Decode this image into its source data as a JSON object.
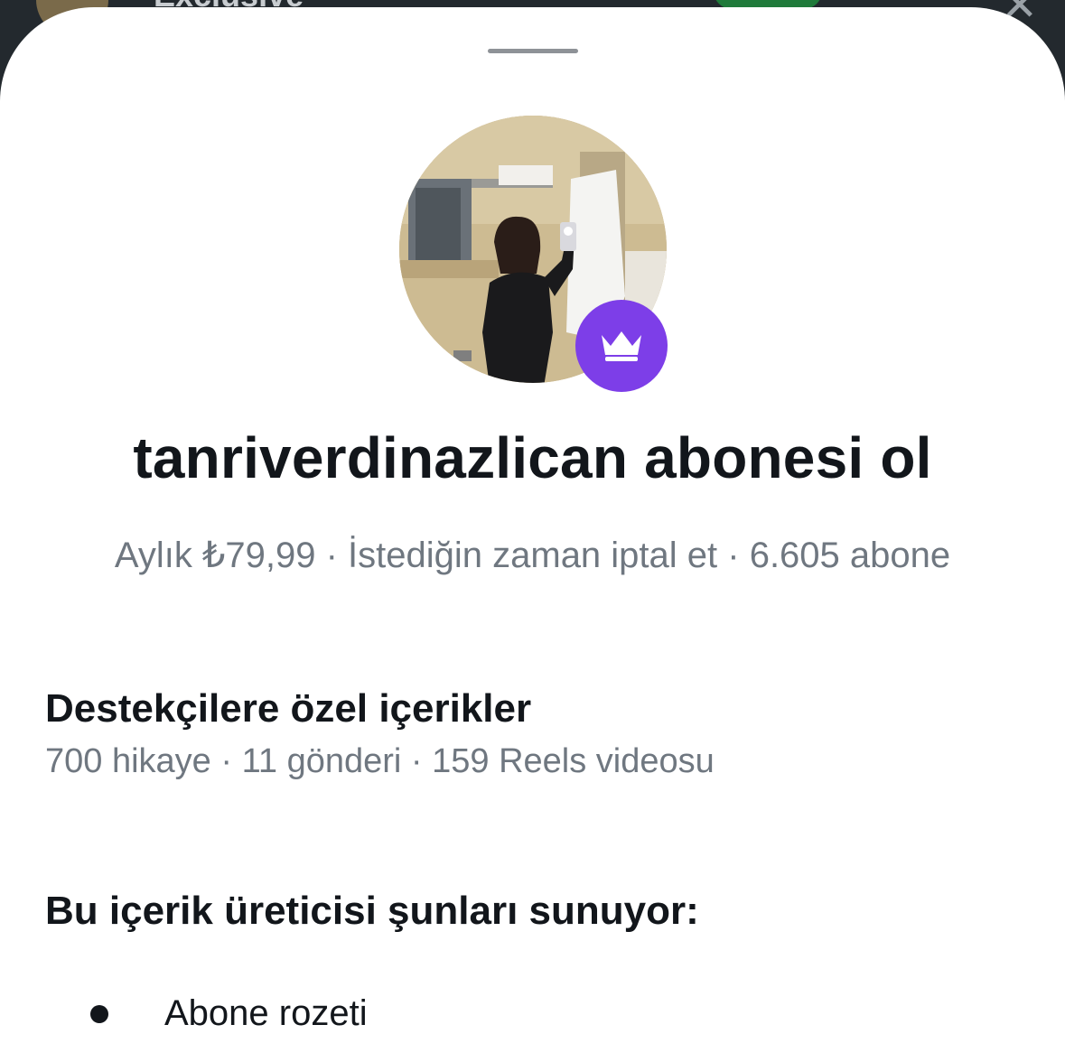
{
  "backdrop": {
    "title": "Exclusive"
  },
  "profile": {
    "avatar_icon": "profile-photo",
    "badge_icon": "crown-icon",
    "badge_color": "#7d3ee8"
  },
  "header": {
    "title": "tanriverdinazlican abonesi ol",
    "subtitle": "Aylık ₺79,99 · İstediğin zaman iptal et · 6.605 abone"
  },
  "exclusive": {
    "heading": "Destekçilere özel içerikler",
    "counts": "700 hikaye · 11 gönderi · 159 Reels videosu"
  },
  "offers": {
    "heading": "Bu içerik üreticisi şunları sunuyor:",
    "items": [
      {
        "label": "Abone rozeti"
      }
    ]
  }
}
